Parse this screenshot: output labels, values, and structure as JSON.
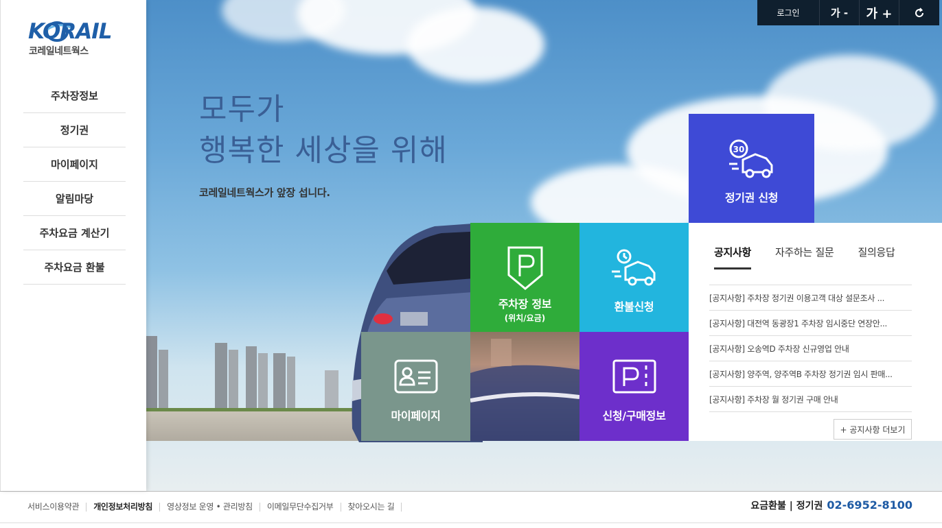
{
  "brand": {
    "logo_word": "KORAIL",
    "logo_sub": "코레일네트웍스"
  },
  "nav": [
    "주차장정보",
    "정기권",
    "마이페이지",
    "알림마당",
    "주차요금 계산기",
    "주차요금 환불"
  ],
  "util": {
    "login": "로그인",
    "font_minus": "가 -",
    "font_plus": "가 +"
  },
  "hero": {
    "title_line1": "모두가",
    "title_line2": "행복한 세상을 위해",
    "subtitle": "코레일네트웍스가 앞장 섭니다."
  },
  "tiles": {
    "season": {
      "label": "정기권 신청",
      "badge": "30"
    },
    "parking": {
      "label": "주차장 정보",
      "sub": "(위치/요금)"
    },
    "refund": {
      "label": "환불신청"
    },
    "mypage": {
      "label": "마이페이지"
    },
    "apply": {
      "label": "신청/구매정보"
    }
  },
  "notice": {
    "tabs": [
      "공지사항",
      "자주하는 질문",
      "질의응답"
    ],
    "items": [
      "[공지사항] 주차장 정기권 이용고객 대상 설문조사 ...",
      "[공지사항] 대전역 동광장1 주차장 임시중단 연장안...",
      "[공지사항] 오송역D 주차장 신규영업 안내",
      "[공지사항] 양주역, 양주역B 주차장 정기권 임시 판매...",
      "[공지사항] 주차장 월 정기권 구매 안내"
    ],
    "more": "+ 공지사항 더보기"
  },
  "footer": {
    "links": [
      "서비스이용약관",
      "개인정보처리방침",
      "영상정보 운영 • 관리방침",
      "이메일무단수집거부",
      "찾아오시는 길"
    ],
    "contact_label": "요금환불 | 정기권",
    "phone": "02-6952-8100"
  },
  "colors": {
    "season": "#3e4ad6",
    "parking": "#2fac3a",
    "refund": "#22b5de",
    "mypage": "#7a968c",
    "apply": "#6d2fcb",
    "brand": "#1f5fa8"
  }
}
